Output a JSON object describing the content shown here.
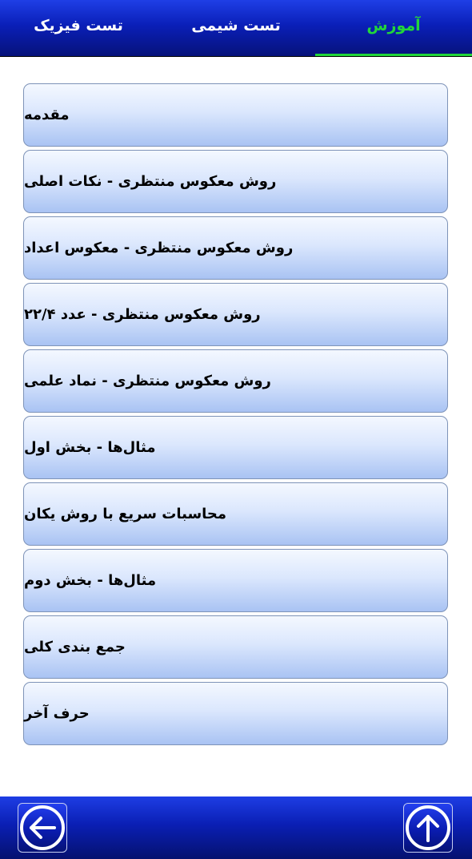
{
  "tabs": [
    {
      "label": "آموزش",
      "active": true
    },
    {
      "label": "تست شیمی",
      "active": false
    },
    {
      "label": "تست فیزیک",
      "active": false
    }
  ],
  "items": [
    {
      "label": "مقدمه"
    },
    {
      "label": "روش معکوس منتظری - نکات اصلی"
    },
    {
      "label": "روش معکوس منتظری - معکوس اعداد"
    },
    {
      "label": "روش معکوس منتظری - عدد ۲۲/۴"
    },
    {
      "label": "روش معکوس منتظری - نماد علمی"
    },
    {
      "label": "مثال‌ها - بخش اول"
    },
    {
      "label": "محاسبات سریع با روش یکان"
    },
    {
      "label": "مثال‌ها - بخش دوم"
    },
    {
      "label": "جمع بندی کلی"
    },
    {
      "label": "حرف آخر"
    }
  ],
  "bottom_bar": {
    "back_icon": "arrow-left-circle-icon",
    "up_icon": "arrow-up-circle-icon"
  },
  "colors": {
    "accent_green": "#22d63a",
    "bar_blue": "#0a1fb8"
  }
}
